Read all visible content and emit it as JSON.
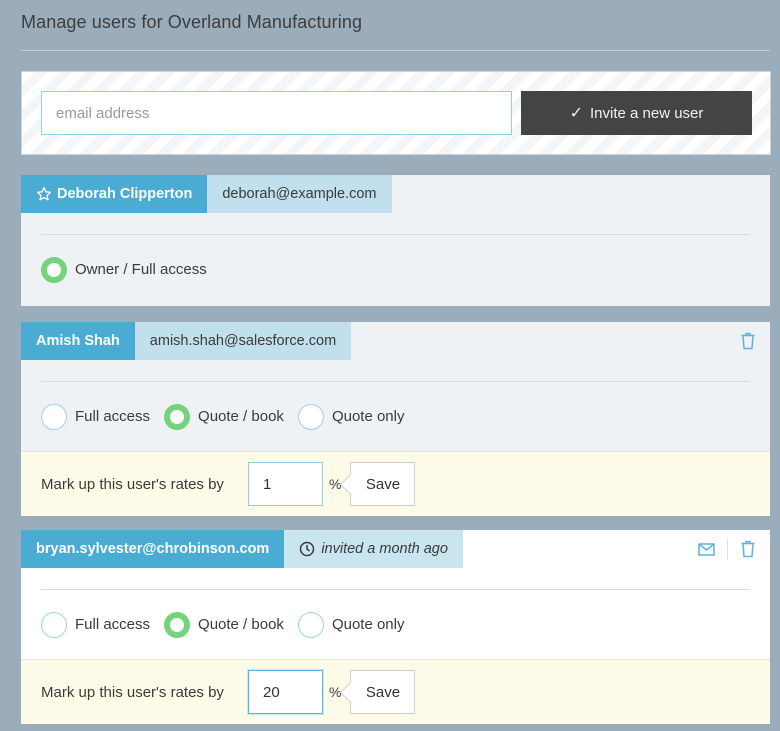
{
  "page": {
    "title": "Manage users for Overland Manufacturing"
  },
  "invite": {
    "email_placeholder": "email address",
    "email_value": "",
    "button_label": "Invite a new user",
    "button_icon": "check-icon"
  },
  "colors": {
    "background": "#9badbb",
    "name_tag": "#4aabd3",
    "email_tag": "#c1dfec",
    "radio_checked": "#74d37b",
    "markup_bg": "#fefce8",
    "invite_button": "#444444"
  },
  "users": [
    {
      "name": "Deborah Clipperton",
      "name_icon": "star-icon",
      "email": "deborah@example.com",
      "role_options": [
        {
          "label": "Owner / Full access",
          "checked": true
        }
      ]
    },
    {
      "name": "Amish Shah",
      "email": "amish.shah@salesforce.com",
      "actions": [
        "trash-icon"
      ],
      "role_options": [
        {
          "label": "Full access",
          "checked": false
        },
        {
          "label": "Quote / book",
          "checked": true
        },
        {
          "label": "Quote only",
          "checked": false
        }
      ],
      "markup": {
        "label": "Mark up this user's rates by",
        "value": "1",
        "unit": "%",
        "save_label": "Save"
      }
    },
    {
      "name": "bryan.sylvester@chrobinson.com",
      "status": "invited a month ago",
      "status_icon": "clock-icon",
      "actions": [
        "envelope-icon",
        "trash-icon"
      ],
      "role_options": [
        {
          "label": "Full access",
          "checked": false
        },
        {
          "label": "Quote / book",
          "checked": true
        },
        {
          "label": "Quote only",
          "checked": false
        }
      ],
      "markup": {
        "label": "Mark up this user's rates by",
        "value": "20",
        "unit": "%",
        "save_label": "Save"
      }
    }
  ]
}
